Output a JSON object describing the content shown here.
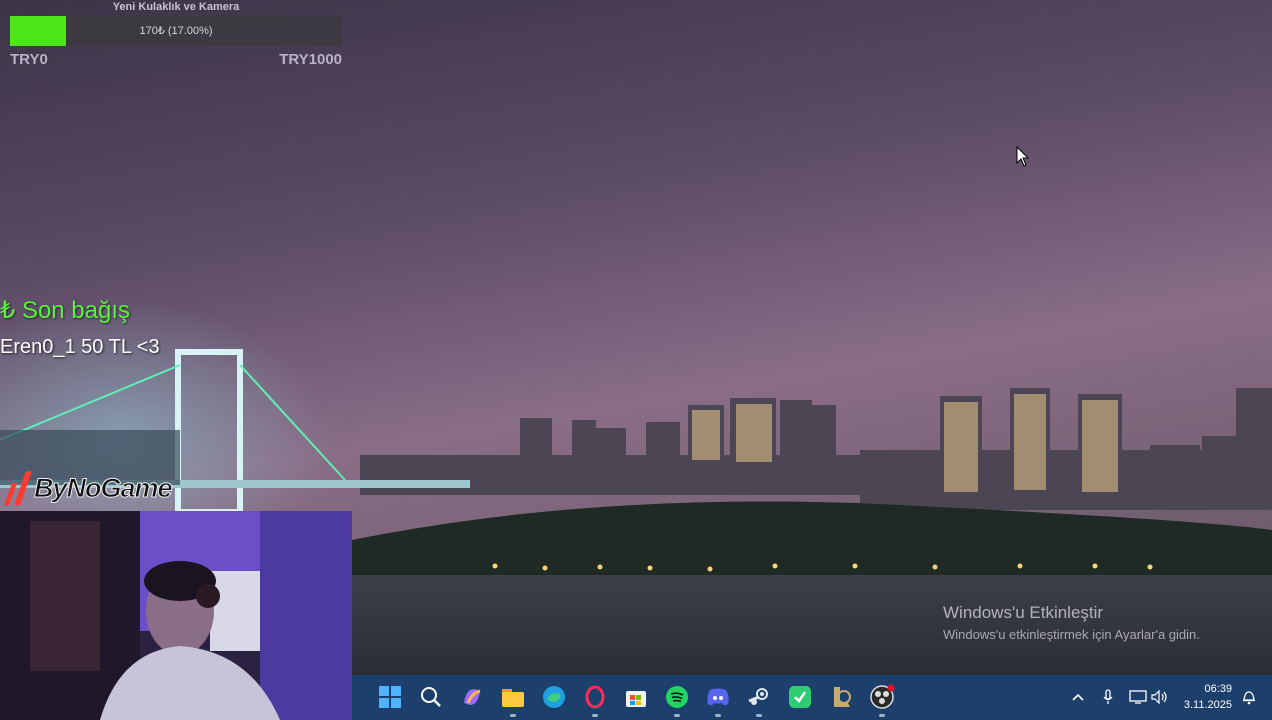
{
  "goal": {
    "title": "Yeni Kulaklık ve Kamera",
    "progress_text": "170₺ (17.00%)",
    "progress_fraction": 0.17,
    "min_label": "TRY0",
    "max_label": "TRY1000",
    "fill_color": "#4de619"
  },
  "last_donation": {
    "title": "₺ Son bağış",
    "text": "Eren0_1 50 TL <3"
  },
  "logo": {
    "text": "ByNoGame"
  },
  "watermark": {
    "title": "Windows'u Etkinleştir",
    "subtitle": "Windows'u etkinleştirmek için Ayarlar'a gidin."
  },
  "taskbar": {
    "icons": [
      "windows-start-icon",
      "search-icon",
      "copilot-icon",
      "file-explorer-icon",
      "edge-icon",
      "opera-gx-icon",
      "microsoft-store-icon",
      "spotify-icon",
      "discord-icon",
      "steam-icon",
      "app-icon",
      "league-of-legends-icon",
      "obs-icon"
    ],
    "tray_icons": [
      "chevron-up-icon",
      "microphone-icon",
      "network-icon",
      "volume-icon"
    ],
    "time": "06:39",
    "date": "3.11.2025"
  }
}
